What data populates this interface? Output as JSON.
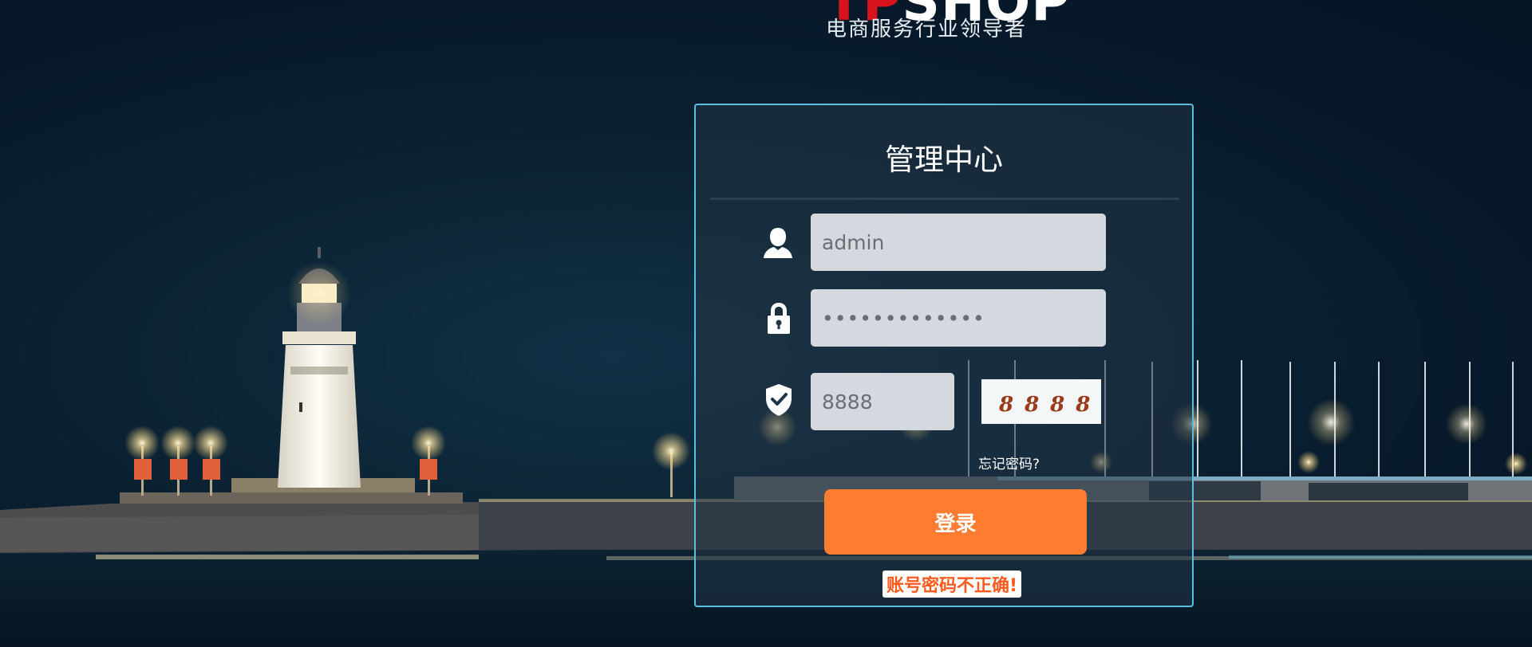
{
  "logo": {
    "brand_part1": "TP",
    "brand_part2": "SHOP",
    "slogan": "电商服务行业领导者",
    "brand_red": "#d7141c"
  },
  "login": {
    "title": "管理中心",
    "username": {
      "value": "admin",
      "icon": "user-icon"
    },
    "password": {
      "value": "•••••••••••••",
      "icon": "lock-icon"
    },
    "captcha": {
      "value": "8888",
      "icon": "shield-check-icon",
      "image_text": "8888"
    },
    "forgot_password": "忘记密码?",
    "submit_label": "登录",
    "error_message": "账号密码不正确!",
    "border_color": "#59c0e0",
    "button_color": "#ff7c30"
  }
}
